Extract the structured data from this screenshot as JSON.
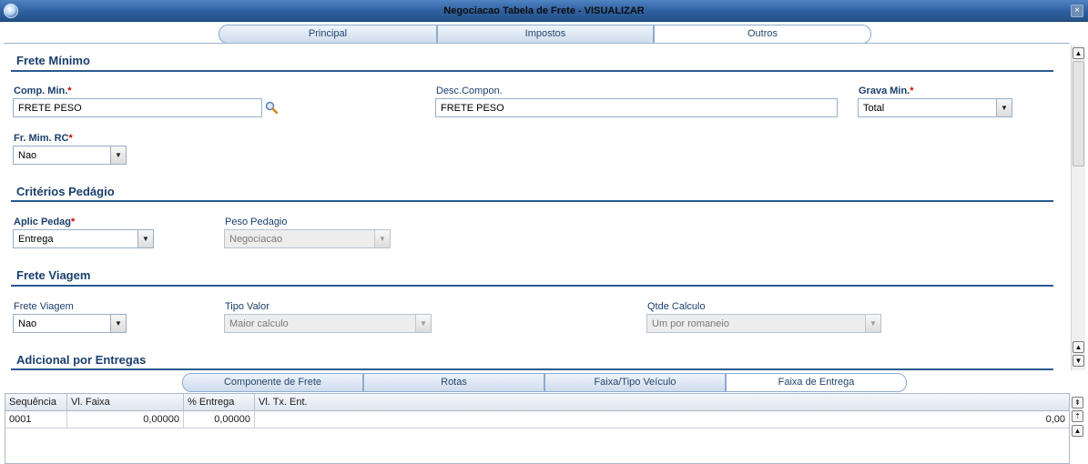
{
  "window": {
    "title": "Negociacao Tabela de Frete - VISUALIZAR",
    "close_glyph": "×"
  },
  "main_tabs": [
    {
      "label": "Principal",
      "active": false
    },
    {
      "label": "Impostos",
      "active": false
    },
    {
      "label": "Outros",
      "active": true
    }
  ],
  "sections": {
    "frete_minimo": "Frete Mínimo",
    "criterios_pedagio": "Critérios Pedágio",
    "frete_viagem": "Frete Viagem",
    "adicional_entregas": "Adicional por Entregas"
  },
  "required_mark": "*",
  "fields": {
    "comp_min": {
      "label": "Comp. Min.",
      "value": "FRETE PESO"
    },
    "desc_compon": {
      "label": "Desc.Compon.",
      "value": "FRETE PESO"
    },
    "grava_min": {
      "label": "Grava Min.",
      "value": "Total"
    },
    "fr_mim_rc": {
      "label": "Fr. Mim. RC",
      "value": "Nao"
    },
    "aplic_pedag": {
      "label": "Aplic Pedag",
      "value": "Entrega"
    },
    "peso_pedagio": {
      "label": "Peso Pedagio",
      "value": "Negociacao"
    },
    "frete_viagem": {
      "label": "Frete Viagem",
      "value": "Nao"
    },
    "tipo_valor": {
      "label": "Tipo Valor",
      "value": "Maior calculo"
    },
    "qtde_calculo": {
      "label": "Qtde Calculo",
      "value": "Um por romaneio"
    }
  },
  "bottom_tabs": [
    {
      "label": "Componente de Frete",
      "active": false
    },
    {
      "label": "Rotas",
      "active": false
    },
    {
      "label": "Faixa/Tipo Veículo",
      "active": false
    },
    {
      "label": "Faixa de Entrega",
      "active": true
    }
  ],
  "grid": {
    "columns": [
      "Sequência",
      "Vl. Faixa",
      "% Entrega",
      "Vl. Tx. Ent."
    ],
    "rows": [
      [
        "0001",
        "0,00000",
        "0,00000",
        "0,00"
      ]
    ]
  },
  "icons": {
    "app": "app-logo-icon",
    "close": "close-icon",
    "search": "magnifier-icon",
    "dropdown": "chevron-down-icon",
    "scroll_up": "arrow-up-icon",
    "scroll_down": "arrow-down-icon"
  },
  "colors": {
    "titlebar": "#2f5f9e",
    "section_text": "#1a3f6c",
    "required": "#d20000",
    "tab_border": "#8eabcf"
  }
}
